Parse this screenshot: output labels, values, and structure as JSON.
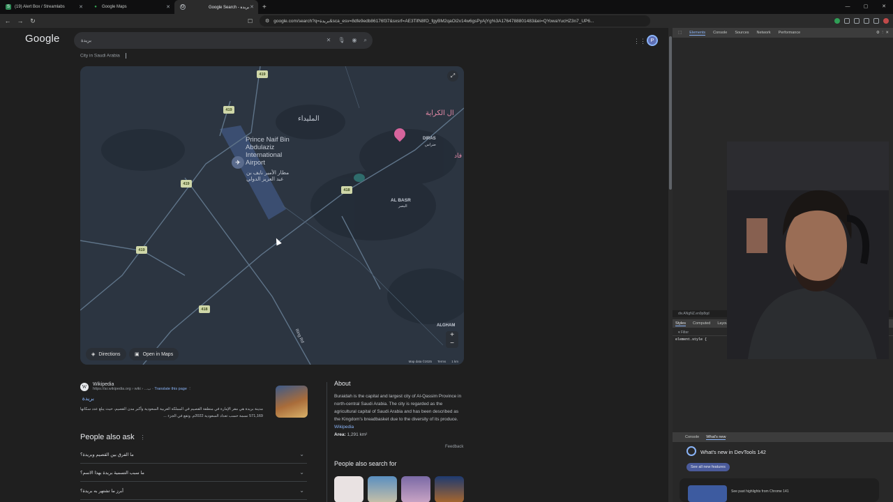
{
  "browser": {
    "tabs": [
      {
        "title": "(19) Alert Box / Streamlabs",
        "active": false
      },
      {
        "title": "Google Maps",
        "active": false
      },
      {
        "title": "Google Search - بريدة",
        "active": true
      }
    ],
    "url": "google.com/search?q=بريدة&sca_esv=8dfe9edb86176f37&sxsrf=AE3TifN8fO_fgyBM2qaOi2v14w6gsPyAjYg%3A1764788801483&ei=QYowaYucHZ3n7_UP6..."
  },
  "google": {
    "logo": "Google",
    "query": "بريدة",
    "avatar_letter": "P",
    "subtitle": "City in Saudi Arabia"
  },
  "map": {
    "labels": {
      "airport": "Prince Naif Bin Abdulaziz International Airport",
      "airport_ar": "مطار الأمير نايف بن عبد العزيز الدولي",
      "area1": "المليداء",
      "area2_ar": "ال الكراية",
      "diras": "DIRAS",
      "diras_ar": "ضراس",
      "albasr": "AL BASR",
      "albasr_ar": "البصر",
      "alghamas": "ALGHAM",
      "ring": "Ring Rd",
      "edge_ar": "فاد"
    },
    "shields": [
      "419",
      "419",
      "419",
      "419",
      "418",
      "418"
    ],
    "buttons": {
      "directions": "Directions",
      "open": "Open in Maps"
    },
    "attribution": {
      "data": "Map data ©2025",
      "terms": "Terms",
      "scale": "1 km"
    }
  },
  "wikipedia": {
    "site": "Wikipedia",
    "crumb": "https://ar.wikipedia.org › wiki › ...ب",
    "translate": "Translate this page",
    "title": "بريدة",
    "snippet": "مدينة بريدة هي مقر الإمارة في منطقة القصيم في المملكة العربية السعودية وأكبر مدن القصيم، حيث يبلغ عدد سكانها 571,169 نسمة حسب تعداد السعودية 2022م. وتقع في الجزء ..."
  },
  "paa": {
    "heading": "People also ask",
    "items": [
      "ما الفرق بين القصيم وبريدة؟",
      "ما سبب التسمية بريدة بهذا الاسم؟",
      "أبرز ما تشتهر به بريدة؟"
    ]
  },
  "about": {
    "heading": "About",
    "text": "Buraidah is the capital and largest city of Al-Qassim Province in north-central Saudi Arabia. The city is regarded as the agricultural capital of Saudi Arabia and has been described as the Kingdom's breadbasket due to the diversity of its produce.",
    "link": "Wikipedia",
    "area_label": "Area:",
    "area_value": "1,291 km²",
    "feedback": "Feedback",
    "people_search": "People also search for"
  },
  "devtools": {
    "tabs": [
      "Elements",
      "Console",
      "Sources",
      "Network",
      "Performance"
    ],
    "breadcrumb": "div.ANgNZ.en0p8qd",
    "style_tabs": [
      "Styles",
      "Computed",
      "Layout"
    ],
    "filter": "Filter",
    "element_style": "element.style {",
    "drawer_tabs": [
      "Console",
      "What's new"
    ],
    "whats_new": "What's new in DevTools 142",
    "see_all": "See all new features",
    "highlights": "See past highlights from Chrome 141"
  },
  "colors": {
    "background": "#1f1f1f",
    "link": "#8ab4f8",
    "map": "#2c3541"
  }
}
